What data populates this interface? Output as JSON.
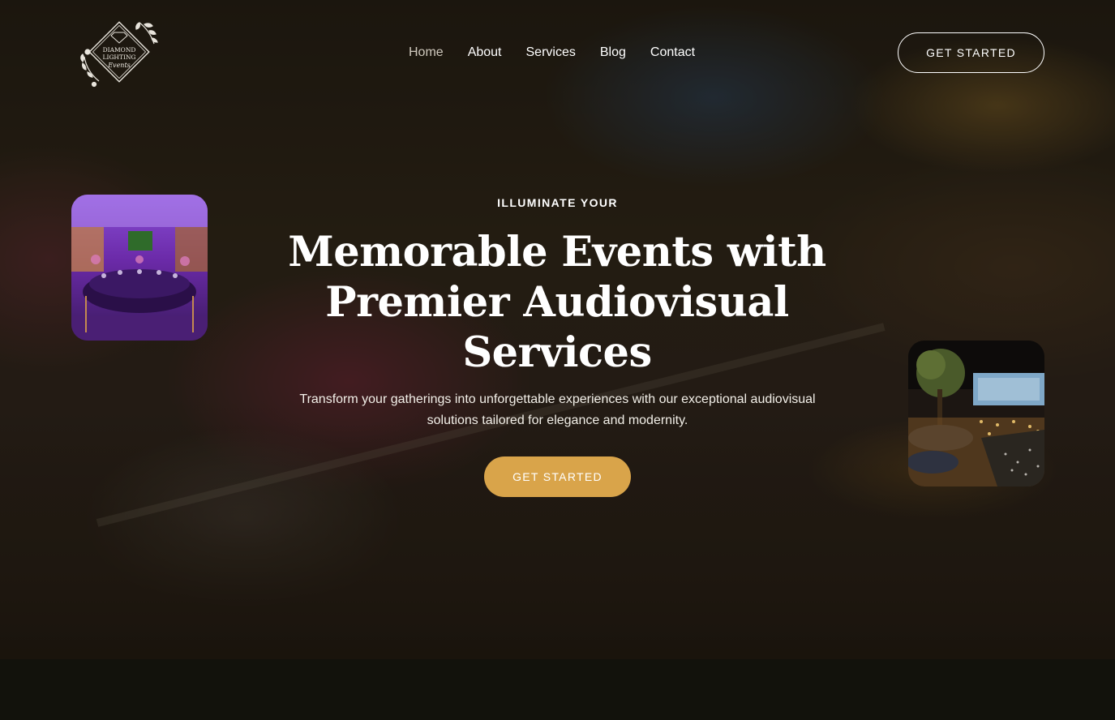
{
  "brand": {
    "logo_lines": [
      "DIAMOND",
      "LIGHTING",
      "Events"
    ]
  },
  "nav": {
    "items": [
      {
        "label": "Home",
        "active": true
      },
      {
        "label": "About",
        "active": false
      },
      {
        "label": "Services",
        "active": false
      },
      {
        "label": "Blog",
        "active": false
      },
      {
        "label": "Contact",
        "active": false
      }
    ]
  },
  "header": {
    "cta_label": "GET STARTED"
  },
  "hero": {
    "eyebrow": "ILLUMINATE YOUR",
    "headline_lines": [
      "Memorable Events with",
      "Premier Audiovisual",
      "Services"
    ],
    "subtitle_lines": [
      "Transform your gatherings into unforgettable experiences with our exceptional audiovisual",
      "solutions tailored for elegance and modernity."
    ],
    "cta_label": "GET STARTED"
  },
  "colors": {
    "accent_gold": "#d9a44a",
    "page_bg": "#12120c",
    "nav_active": "#cfc9bd"
  },
  "icons": {
    "logo": "diamond-floral-logo-icon"
  }
}
